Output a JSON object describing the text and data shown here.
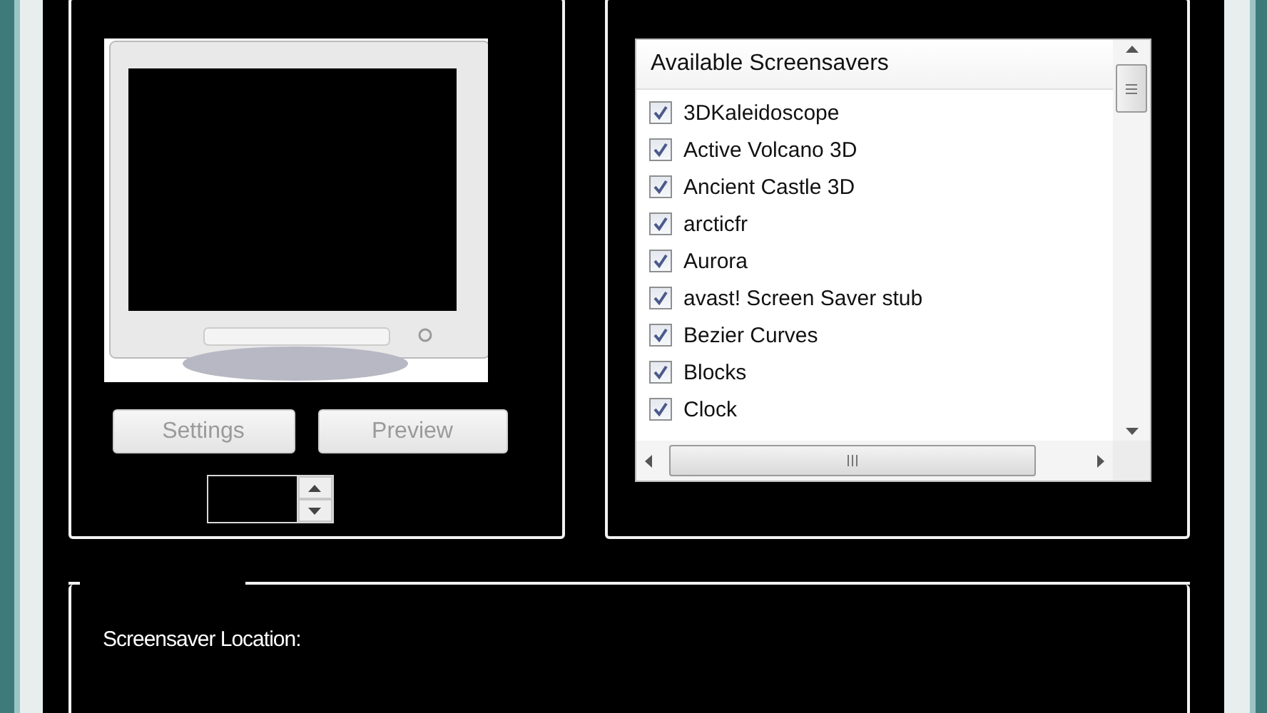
{
  "preview": {
    "buttons": [
      {
        "label": "Settings",
        "disabled": true
      },
      {
        "label": "Preview",
        "disabled": true
      }
    ]
  },
  "screensavers": {
    "header": "Available Screensavers",
    "items": [
      {
        "label": "3DKaleidoscope",
        "checked": true
      },
      {
        "label": "Active Volcano 3D",
        "checked": true
      },
      {
        "label": "Ancient Castle 3D",
        "checked": true
      },
      {
        "label": "arcticfr",
        "checked": true
      },
      {
        "label": "Aurora",
        "checked": true
      },
      {
        "label": "avast! Screen Saver stub",
        "checked": true
      },
      {
        "label": "Bezier Curves",
        "checked": true
      },
      {
        "label": "Blocks",
        "checked": true
      },
      {
        "label": "Clock",
        "checked": true
      }
    ]
  },
  "location": {
    "label": "Screensaver Location:"
  }
}
